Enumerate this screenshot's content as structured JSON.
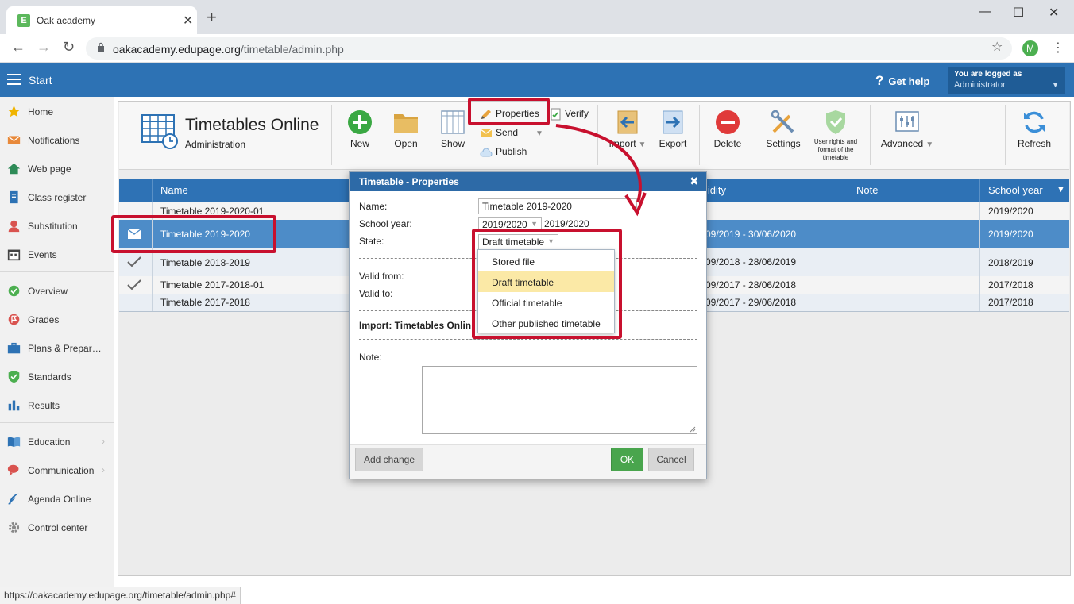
{
  "browser": {
    "tab_title": "Oak academy",
    "favicon_letter": "E",
    "url_host": "oakacademy.edupage.org",
    "url_path": "/timetable/admin.php",
    "profile_initial": "M"
  },
  "appbar": {
    "start_label": "Start",
    "help_label": "Get help",
    "logged_title": "You are logged as",
    "logged_user": "Administrator"
  },
  "sidebar": {
    "items": [
      {
        "label": "Home",
        "icon": "star-icon",
        "color": "#f0b400"
      },
      {
        "label": "Notifications",
        "icon": "envelope-icon",
        "color": "#e8893a"
      },
      {
        "label": "Web page",
        "icon": "house-icon",
        "color": "#2e8b57"
      },
      {
        "label": "Class register",
        "icon": "book-icon",
        "color": "#2d72b4"
      },
      {
        "label": "Substitution",
        "icon": "person-icon",
        "color": "#d9534f"
      },
      {
        "label": "Events",
        "icon": "calendar-icon",
        "color": "#444444"
      },
      {
        "label": "Overview",
        "icon": "check-circle-icon",
        "color": "#4caf50"
      },
      {
        "label": "Grades",
        "icon": "flag-circle-icon",
        "color": "#d9534f"
      },
      {
        "label": "Plans & Prepar…",
        "icon": "briefcase-icon",
        "color": "#2d72b4"
      },
      {
        "label": "Standards",
        "icon": "shield-check-icon",
        "color": "#4caf50"
      },
      {
        "label": "Results",
        "icon": "bar-chart-icon",
        "color": "#2d72b4"
      },
      {
        "label": "Education",
        "icon": "open-book-icon",
        "color": "#2d72b4"
      },
      {
        "label": "Communication",
        "icon": "chat-icon",
        "color": "#d9534f"
      },
      {
        "label": "Agenda Online",
        "icon": "feather-icon",
        "color": "#2d72b4"
      },
      {
        "label": "Control center",
        "icon": "gear-icon",
        "color": "#888888"
      }
    ]
  },
  "ribbon": {
    "title": "Timetables Online",
    "subtitle": "Administration",
    "new": "New",
    "open": "Open",
    "show": "Show",
    "properties": "Properties",
    "verify": "Verify",
    "send": "Send",
    "publish": "Publish",
    "import": "Import",
    "export": "Export",
    "delete": "Delete",
    "settings": "Settings",
    "user_rights_l1": "User rights and",
    "user_rights_l2": "format of the",
    "user_rights_l3": "timetable",
    "advanced": "Advanced",
    "refresh": "Refresh"
  },
  "table": {
    "headers": {
      "name": "Name",
      "validity": "lidity",
      "note": "Note",
      "school_year": "School year"
    },
    "rows": [
      {
        "name": "Timetable 2019-2020-01",
        "validity": "",
        "note": "",
        "year": "2019/2020"
      },
      {
        "name": "Timetable 2019-2020",
        "validity": "09/2019 - 30/06/2020",
        "note": "",
        "year": "2019/2020"
      },
      {
        "name": "Timetable 2018-2019",
        "validity": "09/2018 - 28/06/2019",
        "note": "",
        "year": "2018/2019"
      },
      {
        "name": "Timetable 2017-2018-01",
        "validity": "09/2017 - 28/06/2018",
        "note": "",
        "year": "2017/2018"
      },
      {
        "name": "Timetable 2017-2018",
        "validity": "09/2017 - 29/06/2018",
        "note": "",
        "year": "2017/2018"
      }
    ]
  },
  "dialog": {
    "title": "Timetable - Properties",
    "name_label": "Name:",
    "name_value": "Timetable 2019-2020",
    "school_year_label": "School year:",
    "school_year_select": "2019/2020",
    "school_year_text": "2019/2020",
    "state_label": "State:",
    "state_value": "Draft timetable",
    "valid_from_label": "Valid from:",
    "valid_to_label": "Valid to:",
    "import_label": "Import: Timetables Onlin",
    "note_label": "Note:",
    "add_change": "Add change",
    "ok": "OK",
    "cancel": "Cancel",
    "state_options": [
      "Stored file",
      "Draft timetable",
      "Official timetable",
      "Other published timetable"
    ],
    "state_selected_index": 1
  },
  "statusbar": {
    "url": "https://oakacademy.edupage.org/timetable/admin.php#"
  },
  "colors": {
    "appbar": "#2d72b4",
    "selected_row": "#4d8cc8",
    "annotation_red": "#c8102e",
    "ok_green": "#49a54d"
  }
}
